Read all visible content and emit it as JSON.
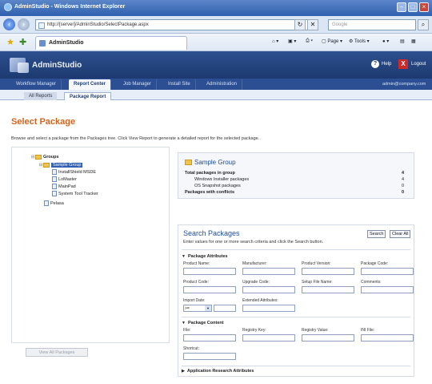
{
  "browser": {
    "window_title": "AdminStudio - Windows Internet Explorer",
    "address": "http://[server]/AdminStudio/SelectPackage.aspx",
    "search_placeholder": "Google",
    "tab_title": "AdminStudio",
    "commands": {
      "page": "Page",
      "tools": "Tools"
    }
  },
  "app": {
    "brand": "AdminStudio",
    "help_label": "Help",
    "logout_label": "Logout",
    "user_email": "admin@company.com",
    "nav_tabs": [
      {
        "label": "Workflow Manager",
        "active": false
      },
      {
        "label": "Report Center",
        "active": true
      },
      {
        "label": "Job Manager",
        "active": false
      },
      {
        "label": "Install Site",
        "active": false
      },
      {
        "label": "Administration",
        "active": false
      }
    ],
    "sub_tabs": [
      {
        "label": "All Reports",
        "active": false
      },
      {
        "label": "Package Report",
        "active": true
      }
    ]
  },
  "page": {
    "title": "Select Package",
    "instructions": "Browse and select a package from the Packages tree. Click View Report to generate a detailed report for the selected package."
  },
  "tree": {
    "root": "Groups",
    "group": "Sample Group",
    "packages": [
      "InstallShield MSDE",
      "LoMaster",
      "MainPad",
      "System Tool Tracker"
    ],
    "other": "Pelasa",
    "view_button": "View All Packages"
  },
  "group_summary": {
    "title": "Sample Group",
    "rows": [
      {
        "label": "Total packages in group",
        "value": "4",
        "bold": true
      },
      {
        "label": "Windows Installer packages",
        "value": "4",
        "bold": false
      },
      {
        "label": "OS Snapshot packages",
        "value": "0",
        "bold": false
      },
      {
        "label": "Packages with conflicts",
        "value": "0",
        "bold": true
      }
    ]
  },
  "search": {
    "title": "Search Packages",
    "hint": "Enter values for one or more search criteria and click the Search button.",
    "search_button": "Search",
    "clear_button": "Clear All",
    "sections": {
      "attributes": "Package Attributes",
      "content": "Package Content",
      "advanced": "Application Research Attributes"
    },
    "attribute_fields": {
      "product_name": "Product Name:",
      "manufacturer": "Manufacturer:",
      "product_version": "Product Version:",
      "package_code": "Package Code:",
      "product_code": "Product Code:",
      "upgrade_code": "Upgrade Code:",
      "setup_file_name": "Setup File Name:",
      "comments": "Comments:",
      "import_date": "Import Date:",
      "extended_attributes": "Extended Attributes:",
      "import_date_value": ">="
    },
    "content_fields": {
      "file": "File:",
      "registry_key": "Registry Key:",
      "registry_value": "Registry Value:",
      "ini_file": "INI File:",
      "shortcut": "Shortcut:"
    }
  }
}
